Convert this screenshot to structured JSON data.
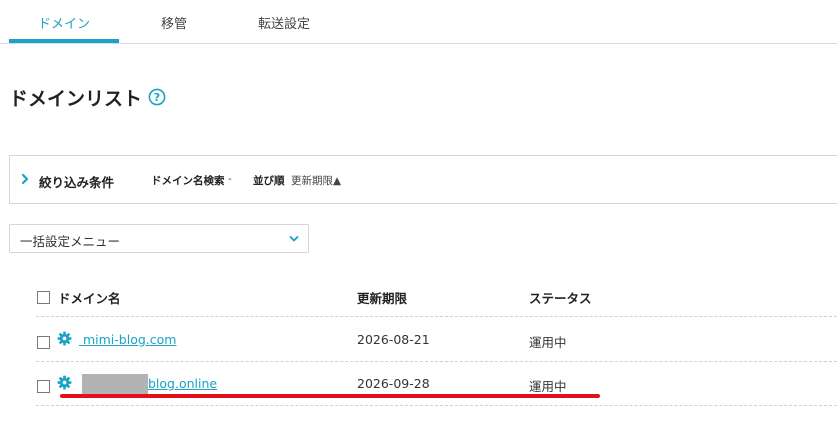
{
  "tabs": [
    {
      "label": "ドメイン",
      "active": true
    },
    {
      "label": "移管",
      "active": false
    },
    {
      "label": "転送設定",
      "active": false
    }
  ],
  "page": {
    "title": "ドメインリスト",
    "help_icon": "question-circle-icon"
  },
  "filter": {
    "title": "絞り込み条件",
    "search_label": "ドメイン名検索",
    "search_value": "-",
    "sort_label": "並び順",
    "sort_value": "更新期限▲"
  },
  "bulk_menu": {
    "selected": "一括設定メニュー"
  },
  "table": {
    "headers": {
      "domain": "ドメイン名",
      "expiry": "更新期限",
      "status": "ステータス"
    },
    "rows": [
      {
        "domain": " mimi-blog.com",
        "expiry": "2026-08-21",
        "status": "運用中",
        "redacted": false
      },
      {
        "domain": "blog.online",
        "expiry": "2026-09-28",
        "status": "運用中",
        "redacted": true
      }
    ]
  },
  "colors": {
    "accent": "#1aa3c4",
    "highlight_underline": "#e3101c"
  }
}
